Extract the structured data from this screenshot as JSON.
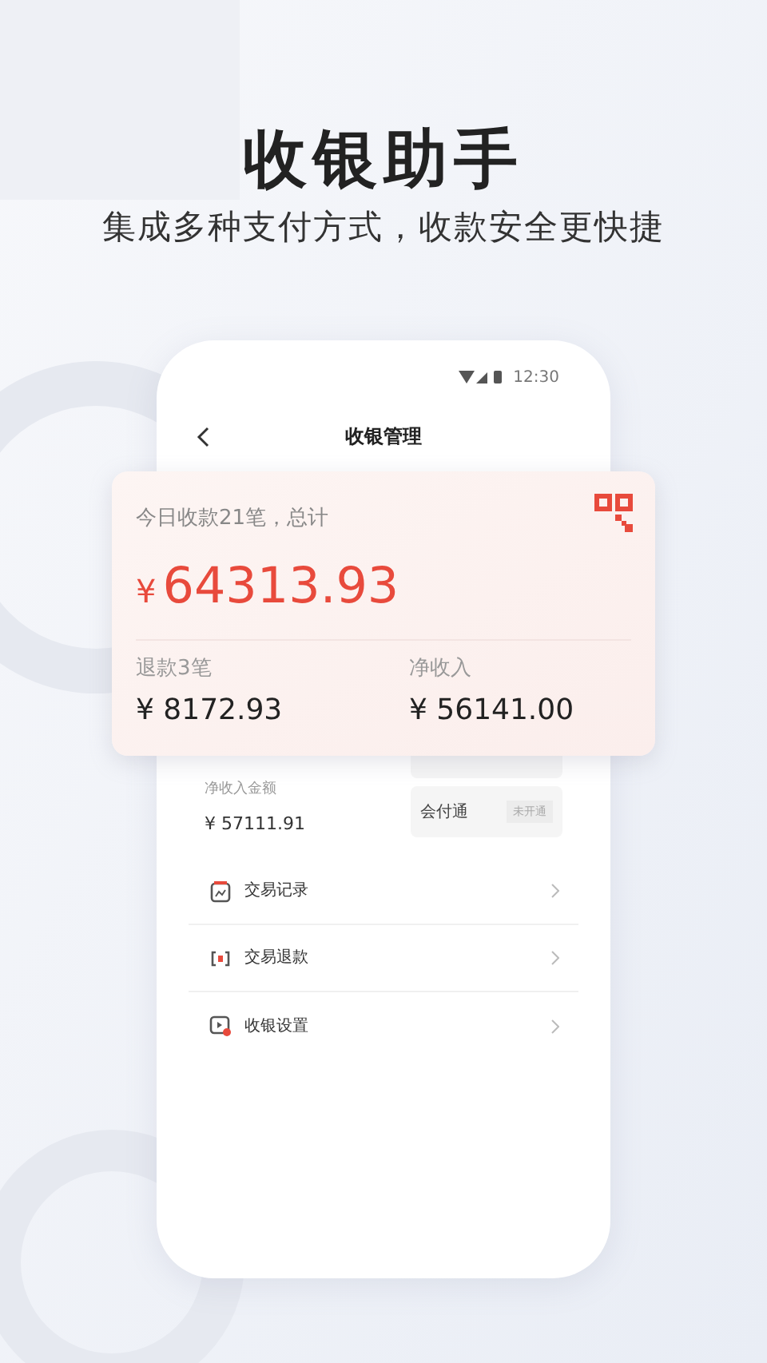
{
  "headline": "收银助手",
  "subtitle": "集成多种支付方式，收款安全更快捷",
  "phone": {
    "status_time": "12:30",
    "nav_title": "收银管理"
  },
  "summary_card": {
    "caption": "今日收款21笔，总计",
    "currency": "¥",
    "total": "64313.93",
    "refunds": {
      "label": "退款3笔",
      "amount": "¥ 8172.93"
    },
    "net": {
      "label": "净收入",
      "amount": "¥ 56141.00"
    }
  },
  "net_amount": {
    "label": "净收入金额",
    "amount": "¥ 57111.91"
  },
  "services": [
    {
      "name": "会付通",
      "status": "未开通"
    }
  ],
  "menu": [
    {
      "label": "交易记录",
      "kind": "records"
    },
    {
      "label": "交易退款",
      "kind": "refund"
    },
    {
      "label": "收银设置",
      "kind": "settings"
    }
  ]
}
